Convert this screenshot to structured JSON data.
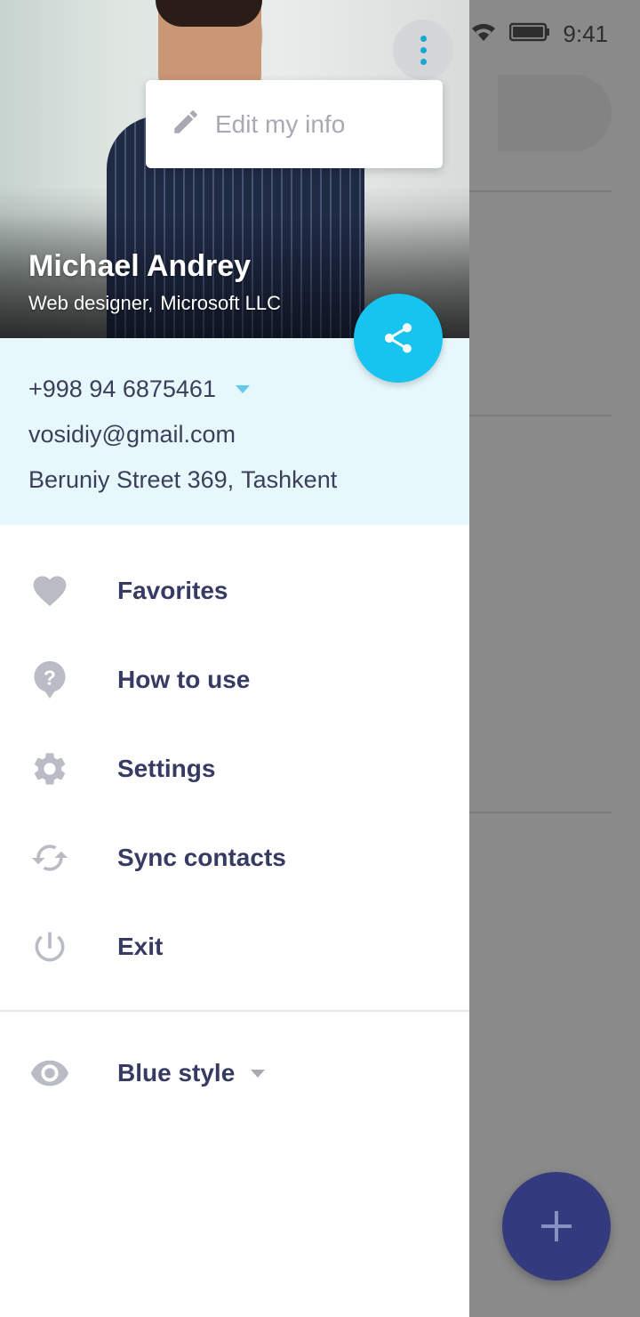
{
  "status_bar": {
    "time": "9:41",
    "icons": [
      "wifi-icon",
      "battery-icon"
    ]
  },
  "profile": {
    "name": "Michael Andrey",
    "job_title": "Web designer,",
    "company": "Microsoft LLC"
  },
  "overflow_menu": {
    "items": [
      {
        "icon": "pencil-icon",
        "label": "Edit my info"
      }
    ]
  },
  "contact": {
    "phone": "+998 94 6875461",
    "email": "vosidiy@gmail.com",
    "street": "Beruniy Street 369,",
    "city": "Tashkent"
  },
  "menu": {
    "items": [
      {
        "icon": "heart-icon",
        "label": "Favorites"
      },
      {
        "icon": "help-icon",
        "label": "How to use"
      },
      {
        "icon": "gear-icon",
        "label": "Settings"
      },
      {
        "icon": "sync-icon",
        "label": "Sync contacts"
      },
      {
        "icon": "power-icon",
        "label": "Exit"
      }
    ]
  },
  "style_selector": {
    "icon": "eye-icon",
    "label": "Blue style"
  },
  "colors": {
    "accent": "#17c4ef",
    "contact_bg": "#e6f8fc",
    "menu_text": "#373b63",
    "fab": "#333a7d",
    "scrim": "#8a8a8a"
  }
}
